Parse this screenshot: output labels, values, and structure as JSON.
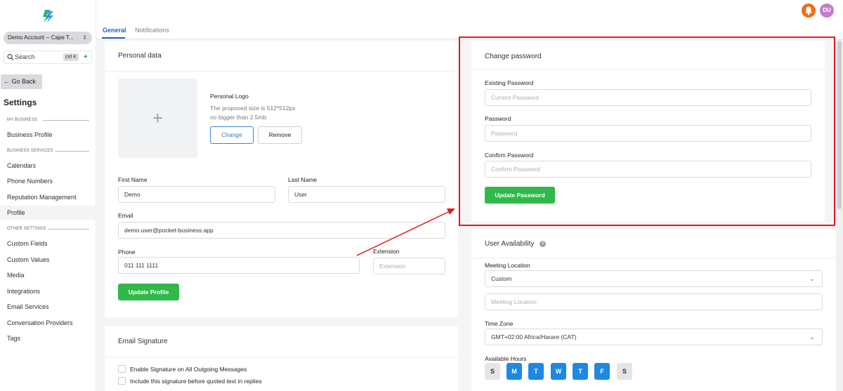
{
  "sidebar": {
    "account": "Demo Account -- Cape T...",
    "search_label": "Search",
    "search_shortcut": "ctrl K",
    "go_back": "Go Back",
    "title": "Settings",
    "section_my_business": "MY BUSINESS",
    "section_business_services": "BUSINESS SERVICES",
    "section_other_settings": "OTHER SETTINGS",
    "items": {
      "business_profile": "Business Profile",
      "calendars": "Calendars",
      "phone_numbers": "Phone Numbers",
      "reputation_management": "Reputation Management",
      "profile": "Profile",
      "custom_fields": "Custom Fields",
      "custom_values": "Custom Values",
      "media": "Media",
      "integrations": "Integrations",
      "email_services": "Email Services",
      "conversation_providers": "Conversation Providers",
      "tags": "Tags"
    }
  },
  "header": {
    "tabs": [
      "General",
      "Notifications"
    ],
    "avatar_initials": "DU"
  },
  "personal_data": {
    "title": "Personal data",
    "logo_title": "Personal Logo",
    "logo_size": "The proposed size is 512*512px",
    "logo_limit": "no bigger than 2.5mb",
    "change_label": "Change",
    "remove_label": "Remove",
    "first_name_label": "First Name",
    "first_name_value": "Demo",
    "last_name_label": "Last Name",
    "last_name_value": "User",
    "email_label": "Email",
    "email_value": "demo.user@pocket-business.app",
    "phone_label": "Phone",
    "phone_value": "011 111 1111",
    "extension_label": "Extension",
    "extension_placeholder": "Extension",
    "update_label": "Update Profile"
  },
  "email_signature": {
    "title": "Email Signature",
    "enable_label": "Enable Signature on All Outgoing Messages",
    "include_label": "Include this signature before quoted text in replies"
  },
  "change_password": {
    "title": "Change password",
    "existing_label": "Existing Password",
    "existing_placeholder": "Current Password",
    "password_label": "Password",
    "password_placeholder": "Password",
    "confirm_label": "Confirm Password",
    "confirm_placeholder": "Confirm Password",
    "update_label": "Update Password"
  },
  "availability": {
    "title": "User Availability",
    "meeting_location_label": "Meeting Location",
    "meeting_location_value": "Custom",
    "meeting_location_placeholder": "Meeting Location",
    "timezone_label": "Time Zone",
    "timezone_value": "GMT+02:00 Africa/Harare (CAT)",
    "hours_label": "Available Hours",
    "days": [
      {
        "label": "S",
        "active": false
      },
      {
        "label": "M",
        "active": true
      },
      {
        "label": "T",
        "active": true
      },
      {
        "label": "W",
        "active": true
      },
      {
        "label": "T",
        "active": true
      },
      {
        "label": "F",
        "active": true
      },
      {
        "label": "S",
        "active": false
      }
    ]
  },
  "colors": {
    "accent_blue": "#1f64c9",
    "green": "#30b94a",
    "highlight_red": "#e01b22",
    "bell_orange": "#f26c1c",
    "avatar_purple": "#c47ecb"
  }
}
